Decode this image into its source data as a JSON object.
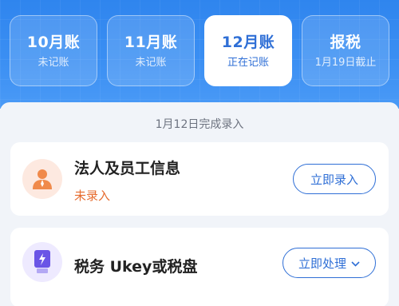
{
  "months": [
    {
      "title": "10月账",
      "subtitle": "未记账"
    },
    {
      "title": "11月账",
      "subtitle": "未记账"
    },
    {
      "title": "12月账",
      "subtitle": "正在记账"
    },
    {
      "title": "报税",
      "subtitle": "1月19日截止"
    }
  ],
  "notice": "1月12日完成录入",
  "tasks": [
    {
      "title": "法人及员工信息",
      "status": "未录入",
      "button": "立即录入",
      "icon": "person-icon"
    },
    {
      "title": "税务 Ukey或税盘",
      "button": "立即处理",
      "icon": "ukey-icon"
    }
  ],
  "colors": {
    "primary": "#2f6fd6",
    "warning": "#e66b2e",
    "hero": "#3b8ff3"
  }
}
